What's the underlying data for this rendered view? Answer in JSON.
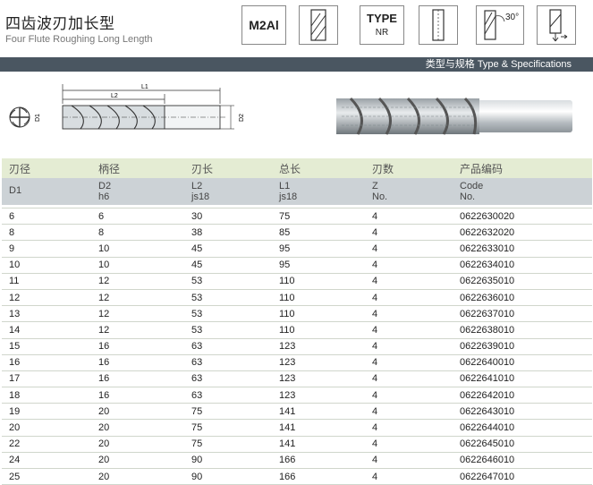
{
  "title": {
    "cn": "四齿波刃加长型",
    "en": "Four Flute Roughing Long Length"
  },
  "badges": {
    "material": "M2Al",
    "type_label": "TYPE",
    "type_value": "NR",
    "angle": "30°"
  },
  "section_bar": "类型与规格  Type & Specifications",
  "drawing_labels": {
    "l1": "L1",
    "l2": "L2",
    "d1": "D1",
    "d2": "D2"
  },
  "table": {
    "header_cn": [
      "刃径",
      "柄径",
      "刃长",
      "总长",
      "刃数",
      "产品编码"
    ],
    "header_en": [
      {
        "main": "D1",
        "sub": ""
      },
      {
        "main": "D2",
        "sub": "h6"
      },
      {
        "main": "L2",
        "sub": "js18"
      },
      {
        "main": "L1",
        "sub": "js18"
      },
      {
        "main": "Z",
        "sub": "No."
      },
      {
        "main": "Code",
        "sub": "No."
      }
    ],
    "rows": [
      [
        "6",
        "6",
        "30",
        "75",
        "4",
        "0622630020"
      ],
      [
        "8",
        "8",
        "38",
        "85",
        "4",
        "0622632020"
      ],
      [
        "9",
        "10",
        "45",
        "95",
        "4",
        "0622633010"
      ],
      [
        "10",
        "10",
        "45",
        "95",
        "4",
        "0622634010"
      ],
      [
        "11",
        "12",
        "53",
        "110",
        "4",
        "0622635010"
      ],
      [
        "12",
        "12",
        "53",
        "110",
        "4",
        "0622636010"
      ],
      [
        "13",
        "12",
        "53",
        "110",
        "4",
        "0622637010"
      ],
      [
        "14",
        "12",
        "53",
        "110",
        "4",
        "0622638010"
      ],
      [
        "15",
        "16",
        "63",
        "123",
        "4",
        "0622639010"
      ],
      [
        "16",
        "16",
        "63",
        "123",
        "4",
        "0622640010"
      ],
      [
        "17",
        "16",
        "63",
        "123",
        "4",
        "0622641010"
      ],
      [
        "18",
        "16",
        "63",
        "123",
        "4",
        "0622642010"
      ],
      [
        "19",
        "20",
        "75",
        "141",
        "4",
        "0622643010"
      ],
      [
        "20",
        "20",
        "75",
        "141",
        "4",
        "0622644010"
      ],
      [
        "22",
        "20",
        "75",
        "141",
        "4",
        "0622645010"
      ],
      [
        "24",
        "20",
        "90",
        "166",
        "4",
        "0622646010"
      ],
      [
        "25",
        "20",
        "90",
        "166",
        "4",
        "0622647010"
      ]
    ]
  }
}
